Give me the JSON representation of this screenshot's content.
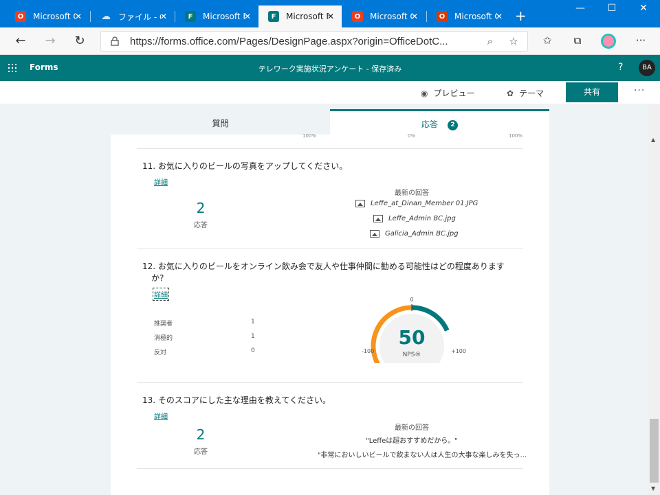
{
  "browser": {
    "tabs": [
      {
        "title": "Microsoft Office",
        "color": "#ea3e23",
        "glyph": "O"
      },
      {
        "title": "ファイル - OneDrive",
        "color": "#0f6cbd",
        "glyph": "☁"
      },
      {
        "title": "Microsoft Forms",
        "color": "#03787c",
        "glyph": "F"
      },
      {
        "title": "Microsoft Forms",
        "color": "#03787c",
        "glyph": "F"
      },
      {
        "title": "Microsoft Office",
        "color": "#ea3e23",
        "glyph": "O"
      },
      {
        "title": "Microsoft Office",
        "color": "#d83b01",
        "glyph": "O"
      }
    ],
    "new_tab": "+",
    "minimize": "—",
    "maximize": "☐",
    "close": "✕",
    "url": "https://forms.office.com/Pages/DesignPage.aspx?origin=OfficeDotC..."
  },
  "app": {
    "name": "Forms",
    "doc_title": "テレワーク実施状況アンケート - 保存済み",
    "help": "?",
    "avatar": "BA"
  },
  "commands": {
    "preview": "プレビュー",
    "theme": "テーマ",
    "share": "共有",
    "more": "···"
  },
  "tabs": {
    "questions": "質問",
    "responses": "応答",
    "response_count": "2"
  },
  "cut_labels": [
    "100%",
    "0%",
    "100%"
  ],
  "q11": {
    "number": "11.",
    "title": "お気に入りのビールの写真をアップしてください。",
    "detail": "詳細",
    "count": "2",
    "count_label": "応答",
    "latest_header": "最新の回答",
    "files": [
      "Leffe_at_Dinan_Member 01.JPG",
      "Leffe_Admin BC.jpg",
      "Galicia_Admin BC.jpg"
    ]
  },
  "q12": {
    "number": "12.",
    "title": "お気に入りのビールをオンライン飲み会で友人や仕事仲間に勧める可能性はどの程度ありますか?",
    "detail": "詳細",
    "rows": [
      {
        "label": "推奨者",
        "value": "1"
      },
      {
        "label": "消極的",
        "value": "1"
      },
      {
        "label": "反対",
        "value": "0"
      }
    ],
    "nps": {
      "score": "50",
      "label": "NPS®",
      "min_label": "-100",
      "mid_label": "0",
      "max_label": "+100",
      "score_value": 50,
      "negative_color": "#f7941d",
      "positive_color": "#03787c"
    }
  },
  "q13": {
    "number": "13.",
    "title": "そのスコアにした主な理由を教えてください。",
    "detail": "詳細",
    "count": "2",
    "count_label": "応答",
    "latest_header": "最新の回答",
    "answers": [
      "\"Leffeは超おすすめだから。\"",
      "\"非常においしいビールで飲まない人は人生の大事な楽しみを失っ..."
    ]
  }
}
